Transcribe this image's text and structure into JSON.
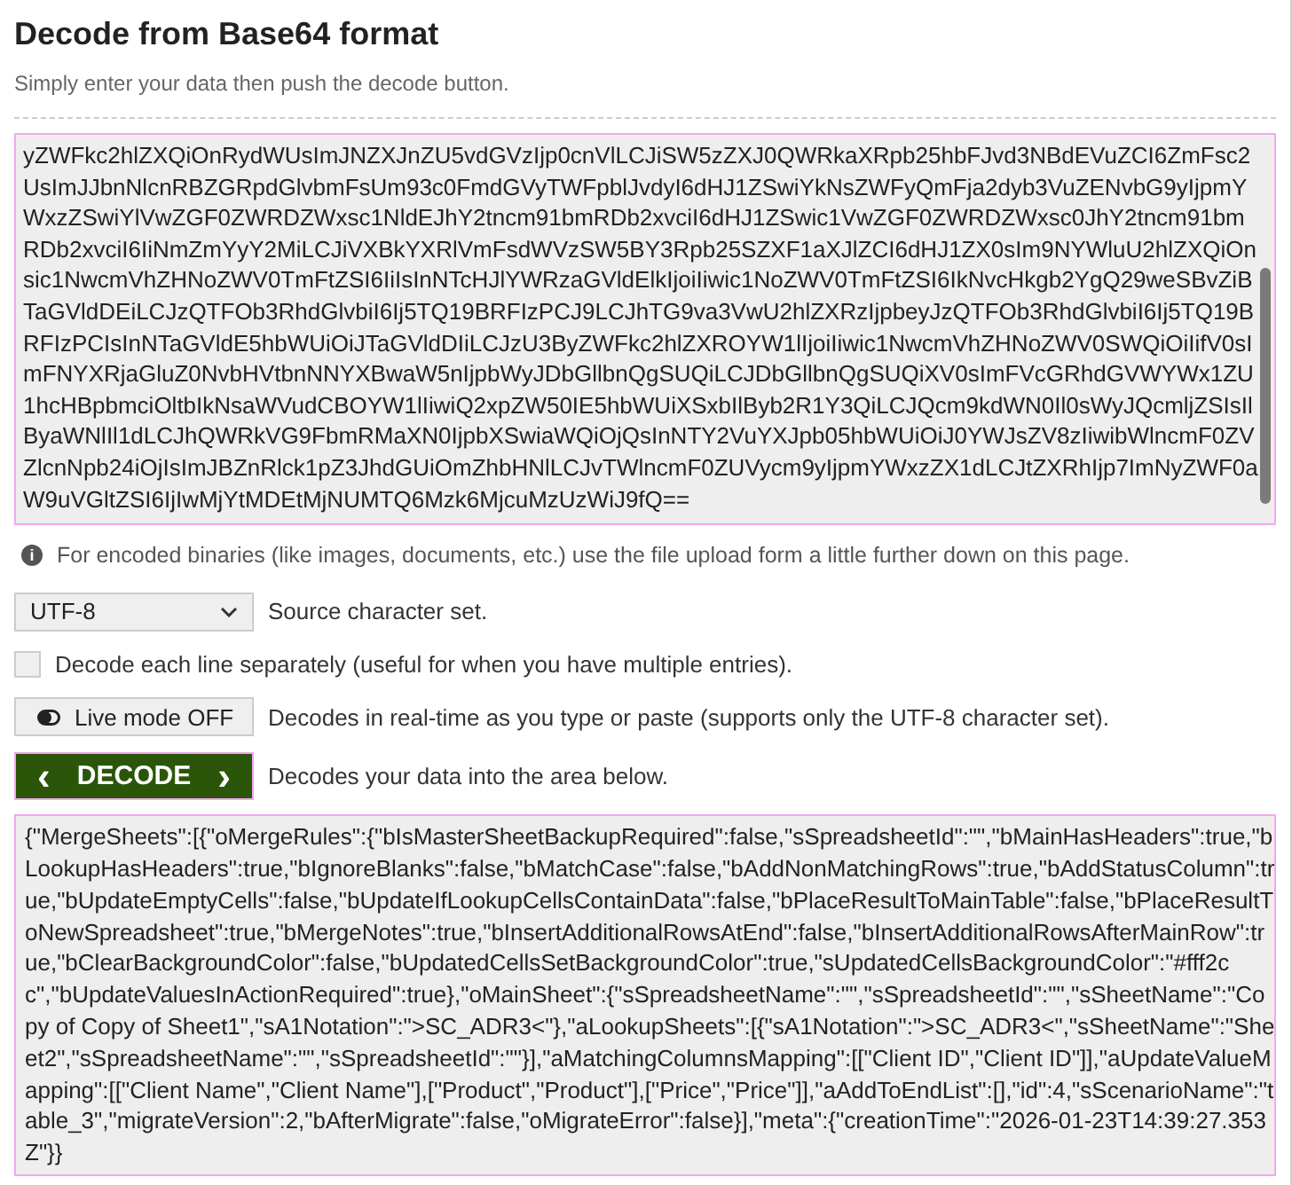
{
  "header": {
    "title": "Decode from Base64 format",
    "subtitle": "Simply enter your data then push the decode button."
  },
  "input": {
    "lines": [
      "yZWFkc2hlZXQiOnRydWUsImJNZXJnZU5vdGVzIjp0cnVlLCJiSW5zZXJ0QWRkaXRpb25hbFJvd3NBdEVuZCI6ZmFsc2",
      "UsImJJbnNlcnRBZGRpdGlvbmFsUm93c0FmdGVyTWFpblJvdyI6dHJ1ZSwiYkNsZWFyQmFja2dyb3VuZENvbG9yIjpmY",
      "WxzZSwiYlVwZGF0ZWRDZWxsc1NldEJhY2tncm91bmRDb2xvciI6dHJ1ZSwic1VwZGF0ZWRDZWxsc0JhY2tncm91bm",
      "RDb2xvciI6IiNmZmYyY2MiLCJiVXBkYXRlVmFsdWVzSW5BY3Rpb25SZXF1aXJlZCI6dHJ1ZX0sIm9NYWluU2hlZXQiOn",
      "sic1NwcmVhZHNoZWV0TmFtZSI6IiIsInNTcHJlYWRzaGVldElkIjoiIiwic1NoZWV0TmFtZSI6IkNvcHkgb2YgQ29weSBvZiB",
      "TaGVldDEiLCJzQTFOb3RhdGlvbiI6Ij5TQ19BRFIzPCJ9LCJhTG9va3VwU2hlZXRzIjpbeyJzQTFOb3RhdGlvbiI6Ij5TQ19B",
      "RFIzPCIsInNTaGVldE5hbWUiOiJTaGVldDIiLCJzU3ByZWFkc2hlZXROYW1lIjoiIiwic1NwcmVhZHNoZWV0SWQiOiIifV0sI",
      "mFNYXRjaGluZ0NvbHVtbnNNYXBwaW5nIjpbWyJDbGllbnQgSUQiLCJDbGllbnQgSUQiXV0sImFVcGRhdGVWYWx1ZU",
      "1hcHBpbmciOltbIkNsaWVudCBOYW1lIiwiQ2xpZW50IE5hbWUiXSxbIlByb2R1Y3QiLCJQcm9kdWN0Il0sWyJQcmljZSIsIl",
      "ByaWNlIl1dLCJhQWRkVG9FbmRMaXN0IjpbXSwiaWQiOjQsInNTY2VuYXJpb05hbWUiOiJ0YWJsZV8zIiwibWlncmF0ZV",
      "ZlcnNpb24iOjIsImJBZnRlck1pZ3JhdGUiOmZhbHNlLCJvTWlncmF0ZUVycm9yIjpmYWxzZX1dLCJtZXRhIjp7ImNyZWF0a",
      "W9uVGltZSI6IjIwMjYtMDEtMjNUMTQ6Mzk6MjcuMzUzWiJ9fQ=="
    ]
  },
  "info": {
    "icon": "i",
    "text": "For encoded binaries (like images, documents, etc.) use the file upload form a little further down on this page."
  },
  "options": [
    {
      "kind": "select",
      "value": "UTF-8",
      "text": "Source character set."
    },
    {
      "kind": "checkbox",
      "checked": false,
      "text": "Decode each line separately (useful for when you have multiple entries)."
    },
    {
      "kind": "toggle",
      "label": "Live mode OFF",
      "on": false,
      "text": "Decodes in real-time as you type or paste (supports only the UTF-8 character set)."
    },
    {
      "kind": "action",
      "label": "DECODE",
      "left": "‹",
      "right": "›",
      "text": "Decodes your data into the area below."
    }
  ],
  "output": {
    "lines": [
      "{\"MergeSheets\":[{\"oMergeRules\":{\"bIsMasterSheetBackupRequired\":false,\"sSpreadsheetId\":\"\",\"bMainHasHeaders\":true,\"b",
      "LookupHasHeaders\":true,\"bIgnoreBlanks\":false,\"bMatchCase\":false,\"bAddNonMatchingRows\":true,\"bAddStatusColumn\":tr",
      "ue,\"bUpdateEmptyCells\":false,\"bUpdateIfLookupCellsContainData\":false,\"bPlaceResultToMainTable\":false,\"bPlaceResultT",
      "oNewSpreadsheet\":true,\"bMergeNotes\":true,\"bInsertAdditionalRowsAtEnd\":false,\"bInsertAdditionalRowsAfterMainRow\":tr",
      "ue,\"bClearBackgroundColor\":false,\"bUpdatedCellsSetBackgroundColor\":true,\"sUpdatedCellsBackgroundColor\":\"#fff2c",
      "c\",\"bUpdateValuesInActionRequired\":true},\"oMainSheet\":{\"sSpreadsheetName\":\"\",\"sSpreadsheetId\":\"\",\"sSheetName\":\"Co",
      "py of Copy of Sheet1\",\"sA1Notation\":\">SC_ADR3<\"},\"aLookupSheets\":[{\"sA1Notation\":\">SC_ADR3<\",\"sSheetName\":\"She",
      "et2\",\"sSpreadsheetName\":\"\",\"sSpreadsheetId\":\"\"}],\"aMatchingColumnsMapping\":[[\"Client ID\",\"Client ID\"]],\"aUpdateValueM",
      "apping\":[[\"Client Name\",\"Client Name\"],[\"Product\",\"Product\"],[\"Price\",\"Price\"]],\"aAddToEndList\":[],\"id\":4,\"sScenarioName\":\"t",
      "able_3\",\"migrateVersion\":2,\"bAfterMigrate\":false,\"oMigrateError\":false}],\"meta\":{\"creationTime\":\"2026-01-23T14:39:27.353",
      "Z\"}}"
    ]
  }
}
